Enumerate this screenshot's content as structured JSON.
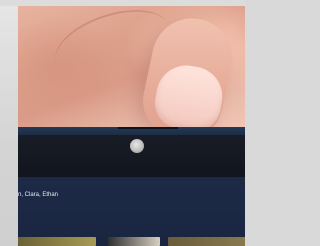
{
  "screen": {
    "shared_with_label": "n, Clara, Ethan"
  }
}
